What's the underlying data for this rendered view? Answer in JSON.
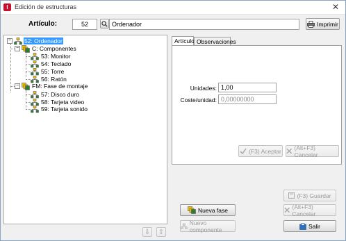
{
  "window": {
    "title": "Edición de estructuras",
    "close_glyph": "✕",
    "app_icon_letter": "I"
  },
  "header": {
    "articulo_label": "Artículo:",
    "articulo_code": "52",
    "articulo_name": "Ordenador",
    "search_icon": "search-icon",
    "print_label": "Imprimir"
  },
  "tree": {
    "nodes": [
      {
        "label": "52: Ordenador",
        "icon": "structure-icon",
        "expander": "−"
      },
      {
        "label": "C: Componentes",
        "icon": "phase-icon",
        "expander": "−"
      },
      {
        "label": "53: Monitor",
        "icon": "structure-icon"
      },
      {
        "label": "54: Teclado",
        "icon": "structure-icon"
      },
      {
        "label": "55: Torre",
        "icon": "structure-icon"
      },
      {
        "label": "56: Ratón",
        "icon": "structure-icon"
      },
      {
        "label": "FM: Fase de montaje",
        "icon": "phase-icon",
        "expander": "−"
      },
      {
        "label": "57: Disco duro",
        "icon": "structure-icon"
      },
      {
        "label": "58: Tarjeta video",
        "icon": "structure-icon"
      },
      {
        "label": "59: Tarjeta sonido",
        "icon": "structure-icon"
      }
    ],
    "move_down_glyph": "⇩",
    "move_up_glyph": "⇧"
  },
  "tabs": [
    {
      "label": "Artículo"
    },
    {
      "label": "Observaciones"
    }
  ],
  "form": {
    "unidades_label": "Unidades:",
    "unidades_value": "1,00",
    "coste_label": "Coste/unidad:",
    "coste_value": "0,00000000",
    "accept_label": "(F3) Aceptar",
    "cancel_label": "(Alt+F3) Cancelar"
  },
  "actions": {
    "nueva_fase_label": "Nueva fase",
    "nuevo_componente_label": "Nuevo componente",
    "guardar_label": "(F3) Guardar",
    "cancelar_label": "(Alt+F3) Cancelar",
    "salir_label": "Salir"
  },
  "colors": {
    "accent": "#c8102e",
    "selection": "#3399ff",
    "icon_yellow": "#f2c200",
    "icon_green": "#2e7d32"
  }
}
